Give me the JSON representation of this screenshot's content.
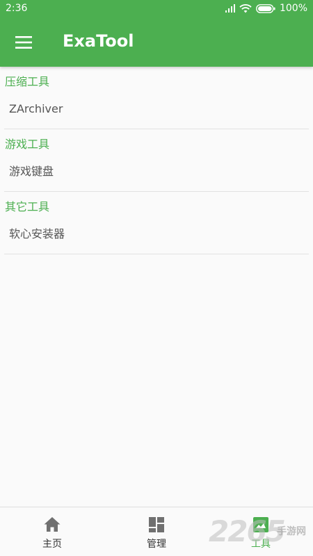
{
  "status_bar": {
    "time": "2:36",
    "battery": "100%"
  },
  "app_bar": {
    "title": "ExaTool",
    "menu_icon": "hamburger-menu-icon",
    "color": "#4caf50"
  },
  "sections": [
    {
      "header": "压缩工具",
      "items": [
        "ZArchiver"
      ]
    },
    {
      "header": "游戏工具",
      "items": [
        "游戏键盘"
      ]
    },
    {
      "header": "其它工具",
      "items": [
        "软心安装器"
      ]
    }
  ],
  "bottom_nav": {
    "items": [
      {
        "label": "主页",
        "icon": "home-icon",
        "active": false
      },
      {
        "label": "管理",
        "icon": "dashboard-icon",
        "active": false
      },
      {
        "label": "工具",
        "icon": "tools-icon",
        "active": true
      }
    ],
    "active_color": "#4caf50"
  },
  "watermark": {
    "number": "2265",
    "text": "手游网"
  }
}
